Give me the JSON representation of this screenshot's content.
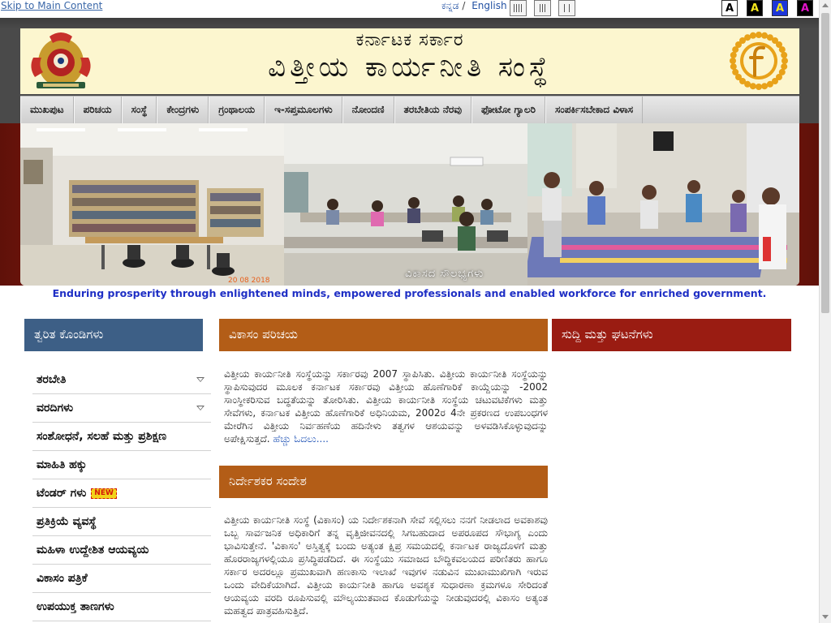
{
  "top_bar": {
    "skip_link": "Skip to Main Content",
    "lang_kannada": "ಕನ್ನಡ",
    "lang_separator": "/",
    "lang_english": "English",
    "contrast": [
      {
        "label": "A",
        "bg": "#ffffff",
        "fg": "#000000"
      },
      {
        "label": "A",
        "bg": "#000000",
        "fg": "#f2e51c"
      },
      {
        "label": "A",
        "bg": "#1d36d8",
        "fg": "#f2e51c"
      },
      {
        "label": "A",
        "bg": "#000000",
        "fg": "#e014c8"
      }
    ]
  },
  "banner": {
    "subtitle": "ಕರ್ನಾಟಕ ಸರ್ಕಾರ",
    "title": "ವಿತ್ತೀಯ ಕಾರ್ಯನೀತಿ ಸಂಸ್ಥೆ",
    "left_logo": "karnataka-emblem-icon",
    "right_logo": "institute-f-logo-icon"
  },
  "nav": {
    "items": [
      "ಮುಖಪುಟ",
      "ಪರಿಚಯ",
      "ಸಂಸ್ಥೆ",
      "ಕೇಂದ್ರಗಳು",
      "ಗ್ರಂಥಾಲಯ",
      "ಇ-ಸಪ್ತಮೂಲಗಳು",
      "ನೋಂದಣಿ",
      "ತರಬೇತಿಯ ನೆರವು",
      "ಫೋಟೋ ಗ್ಯಾಲರಿ",
      "ಸಂಪರ್ಕಿಸಬೇಕಾದ ವಿಳಾಸ"
    ]
  },
  "hero": {
    "caption": "ವಿಕಾಸದ ಸೌಲಭ್ಯಗಳು",
    "date": "20 08 2018"
  },
  "tagline": "Enduring prosperity through enlightened minds, empowered professionals and enabled workforce for enriched government.",
  "quick_links": {
    "heading": "ತ್ವರಿತ ಕೊಂಡಿಗಳು",
    "items": [
      {
        "label": "ತರಬೇತಿ",
        "has_dropdown": true,
        "badge": ""
      },
      {
        "label": "ವರದಿಗಳು",
        "has_dropdown": true,
        "badge": ""
      },
      {
        "label": "ಸಂಶೋಧನೆ, ಸಲಹೆ ಮತ್ತು ಪ್ರಶಿಕ್ಷಣ",
        "has_dropdown": false,
        "badge": ""
      },
      {
        "label": "ಮಾಹಿತಿ ಹಕ್ಕು",
        "has_dropdown": false,
        "badge": ""
      },
      {
        "label": "ಟೆಂಡರ್ ಗಳು",
        "has_dropdown": false,
        "badge": "NEW"
      },
      {
        "label": "ಪ್ರತಿಕ್ರಿಯೆ ವ್ಯವಸ್ಥೆ",
        "has_dropdown": false,
        "badge": ""
      },
      {
        "label": "ಮಹಿಳಾ ಉದ್ದೇಶಿತ ಆಯವ್ಯಯ",
        "has_dropdown": false,
        "badge": ""
      },
      {
        "label": "ವಿಕಾಸಂ ಪತ್ರಿಕೆ",
        "has_dropdown": false,
        "badge": ""
      },
      {
        "label": "ಉಪಯುಕ್ತ ತಾಣಗಳು",
        "has_dropdown": false,
        "badge": ""
      }
    ]
  },
  "intro": {
    "heading": "ವಿಕಾಸಂ ಪರಿಚಯ",
    "text": "ವಿತ್ತೀಯ ಕಾರ್ಯನೀತಿ ಸಂಸ್ಥೆಯನ್ನು ಸರ್ಕಾರವು 2007 ಸ್ಥಾಪಿಸಿತು. ವಿತ್ತೀಯ ಕಾರ್ಯನೀತಿ ಸಂಸ್ಥೆಯನ್ನು ಸ್ಥಾಪಿಸುವುದರ ಮೂಲಕ ಕರ್ನಾಟಕ ಸರ್ಕಾರವು ವಿತ್ತೀಯ ಹೊಣೆಗಾರಿಕೆ ಕಾಯ್ದೆಯನ್ನು -2002 ಸಾಂಸ್ಥೀಕರಿಸುವ ಬದ್ಧತೆಯನ್ನು ತೋರಿಸಿತು. ವಿತ್ತೀಯ ಕಾರ್ಯನೀತಿ ಸಂಸ್ಥೆಯ ಚಟುವಟಿಕೆಗಳು ಮತ್ತು ಸೇವೆಗಳು, ಕರ್ನಾಟಕ ವಿತ್ತೀಯ ಹೊಣೆಗಾರಿಕೆ ಅಧಿನಿಯಮ, 2002ರ 4ನೇ ಪ್ರಕರಣದ ಉಪಬಂಧಗಳ ಮೇರೆಗಿನ ವಿತ್ತೀಯ ನಿರ್ವಹಣೆಯ ಹದಿನೇಳು ತತ್ವಗಳ ಆಶಯವನ್ನು ಅಳವಡಿಸಿಕೊಳ್ಳುವುದನ್ನು ಅಪೇಕ್ಷಿಸುತ್ತದೆ.",
    "more": "ಹೆಚ್ಚು ಓದಲು...."
  },
  "news": {
    "heading": "ಸುದ್ದಿ ಮತ್ತು ಘಟನೆಗಳು"
  },
  "director": {
    "heading": "ನಿರ್ದೇಶಕರ ಸಂದೇಶ",
    "text": "ವಿತ್ತೀಯ ಕಾರ್ಯನೀತಿ ಸಂಸ್ಥೆ (ವಿಕಾಸಂ) ಯ ನಿರ್ದೇಶಕನಾಗಿ ಸೇವೆ ಸಲ್ಲಿಸಲು ನನಗೆ ನೀಡಲಾದ ಅವಕಾಶವು ಒಬ್ಬ ಸಾರ್ವಜನಿಕ ಅಧಿಕಾರಿಗೆ ತನ್ನ ವೃತ್ತಿಜೀವನದಲ್ಲಿ ಸಿಗಬಹುದಾದ ಅಪರೂಪದ ಸೌಭಾಗ್ಯ ಎಂದು ಭಾವಿಸುತ್ತೇನೆ. 'ವಿಕಾಸಂ' ಅಸ್ತಿತ್ವಕ್ಕೆ ಬಂದು ಅತ್ಯಂತ ಕ್ಷಿಪ್ರ ಸಮಯದಲ್ಲಿ ಕರ್ನಾಟಕ ರಾಜ್ಯದೊಳಗೆ ಮತ್ತು ಹೊರರಾಜ್ಯಗಳಲ್ಲಿಯೂ ಪ್ರಸಿದ್ಧಿಪಡೆದಿದೆ. ಈ ಸಂಸ್ಥೆಯು ಸಮಾಜದ ಬೌದ್ಧಿಕವಲಯದ ಪರಿಣಿತರು ಹಾಗೂ ಸರ್ಕಾರ ಅದರಲ್ಲೂ ಪ್ರಮುಖವಾಗಿ ಹಣಕಾಸು ಇಲಾಖೆ ಇವುಗಳ ನಡುವಿನ ಮುಖಾಮುಖಿಗಾಗಿ ಇರುವ ಒಂದು ವೇದಿಕೆಯಾಗಿದೆ. ವಿತ್ತೀಯ ಕಾರ್ಯನೀತಿ ಹಾಗೂ ಅವಶ್ಯಕ ಸುಧಾರಣಾ ಕ್ರಮಗಳೂ ಸೇರಿದಂತೆ ಆಯವ್ಯಯ ವರದಿ ರೂಪಿಸುವಲ್ಲಿ ಮೌಲ್ಯಯುತವಾದ ಕೊಡುಗೆಯನ್ನು ನೀಡುವುದರಲ್ಲಿ ವಿಕಾಸಂ ಅತ್ಯಂತ ಮಹತ್ವದ ಪಾತ್ರವಹಿಸುತ್ತಿದೆ."
  },
  "colors": {
    "nav_bg": "#d9d9d9",
    "quick_head": "#3d5f86",
    "intro_head": "#b35d17",
    "news_head": "#9a1c12",
    "banner_bg": "#fcf6cf",
    "tagline": "#1f2fc5"
  }
}
